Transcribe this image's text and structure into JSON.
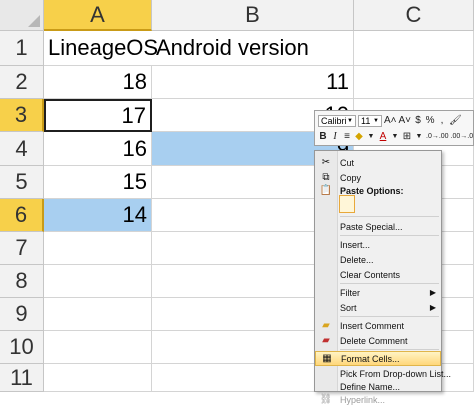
{
  "columns": [
    "A",
    "B",
    "C"
  ],
  "rows": [
    "1",
    "2",
    "3",
    "4",
    "5",
    "6",
    "7",
    "8",
    "9",
    "10",
    "11"
  ],
  "cells": {
    "a1": "LineageOS",
    "b1": "Android version",
    "a2": "18",
    "b2": "11",
    "a3": "17",
    "b3": "10",
    "a4": "16",
    "b4": "9",
    "a5": "15",
    "a6": "14"
  },
  "mini_toolbar": {
    "font_name": "Calibri",
    "font_size": "11",
    "grow_font": "A˄",
    "shrink_font": "A˅",
    "currency": "$",
    "percent": "%",
    "comma": ",",
    "bold": "B",
    "italic": "I",
    "increase_decimal": ".0→.00",
    "decrease_decimal": ".00→.0"
  },
  "context_menu": {
    "cut": "Cut",
    "copy": "Copy",
    "paste_options": "Paste Options:",
    "paste_special": "Paste Special...",
    "insert": "Insert...",
    "delete": "Delete...",
    "clear_contents": "Clear Contents",
    "filter": "Filter",
    "sort": "Sort",
    "insert_comment": "Insert Comment",
    "delete_comment": "Delete Comment",
    "format_cells": "Format Cells...",
    "pick_dropdown": "Pick From Drop-down List...",
    "define_name": "Define Name...",
    "hyperlink": "Hyperlink..."
  },
  "colors": {
    "header_selected": "#f7d04a",
    "cell_highlight": "#a8cff0",
    "menu_hover": "#ffd77a"
  }
}
